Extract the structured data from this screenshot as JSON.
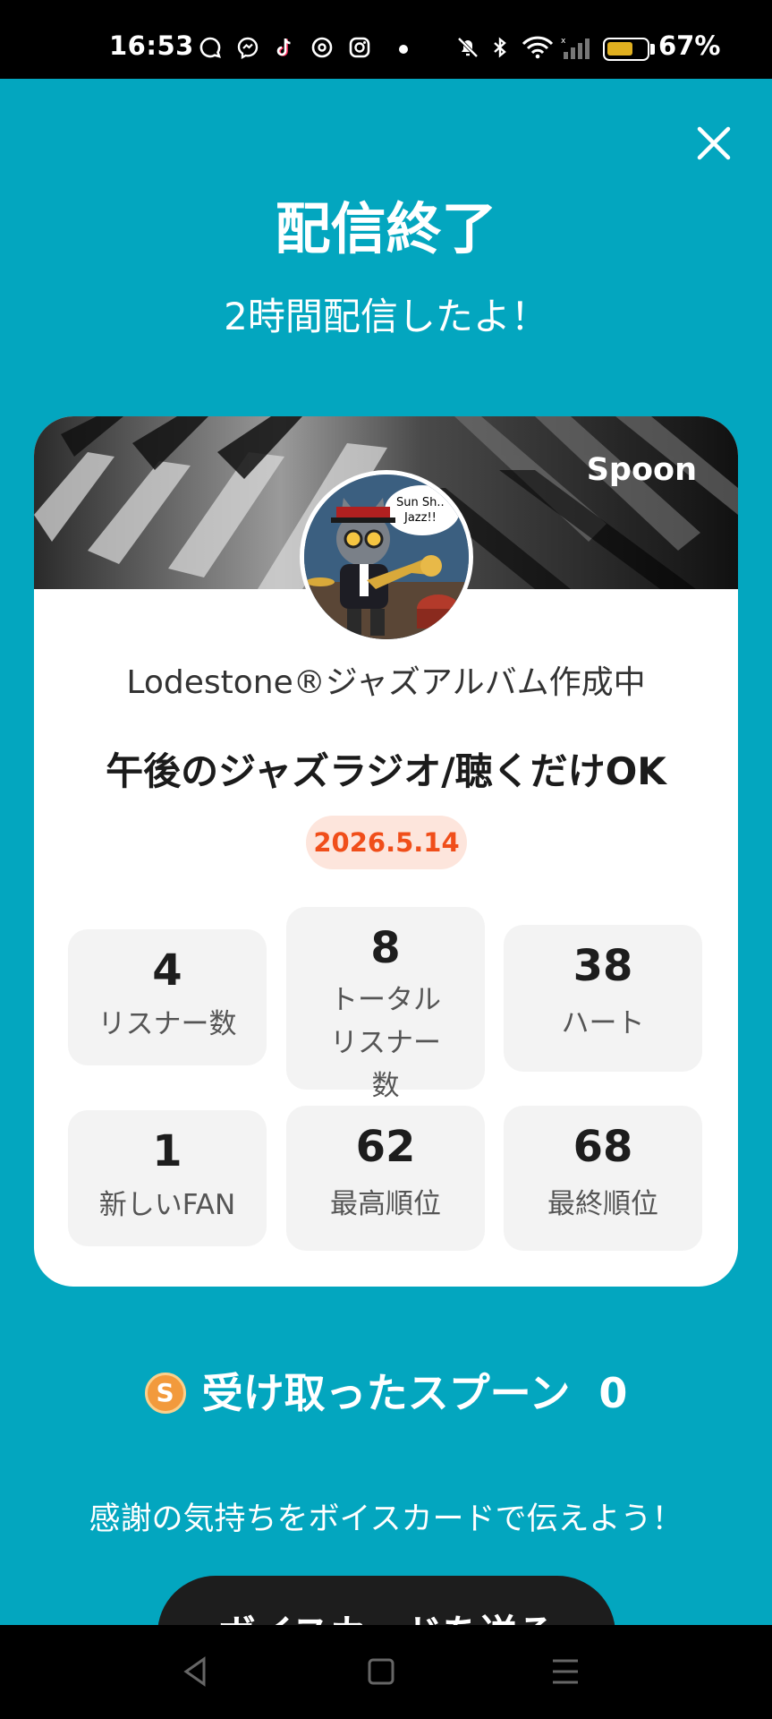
{
  "status_bar": {
    "time": "16:53",
    "battery_percent_label": "67%",
    "battery_level": 0.67,
    "icons": [
      "chat-icon",
      "messenger-icon",
      "tiktok-icon",
      "threads-icon",
      "instagram-icon",
      "notification-dot",
      "mute-icon",
      "bluetooth-icon",
      "wifi-icon",
      "signal-icon",
      "battery-icon"
    ]
  },
  "header": {
    "title": "配信終了",
    "subtitle": "2時間配信したよ！",
    "close_icon": "close-icon"
  },
  "card": {
    "brand": "Spoon",
    "host_name": "Lodestone®ジャズアルバム作成中",
    "live_title": "午後のジャズラジオ/聴くだけOK",
    "date": "2026.5.14",
    "avatar_bubble": "Sun Sh.. Jazz!!",
    "stats": [
      {
        "value": "4",
        "label": "リスナー数"
      },
      {
        "value": "8",
        "label": "トータルリスナー数"
      },
      {
        "value": "38",
        "label": "ハート"
      },
      {
        "value": "1",
        "label": "新しいFAN"
      },
      {
        "value": "62",
        "label": "最高順位"
      },
      {
        "value": "68",
        "label": "最終順位"
      }
    ]
  },
  "spoons": {
    "coin_letter": "S",
    "label": "受け取ったスプーン",
    "count": "0"
  },
  "footer": {
    "thanks": "感謝の気持ちをボイスカードで伝えよう！",
    "voice_card_button": "ボイスカードを送る"
  },
  "nav": {
    "back": "back-icon",
    "home": "home-icon",
    "menu": "menu-icon"
  },
  "colors": {
    "background": "#03a6bf",
    "date_text": "#f04e1a",
    "date_bg": "#fde5dc",
    "coin": "#f29a3c"
  }
}
